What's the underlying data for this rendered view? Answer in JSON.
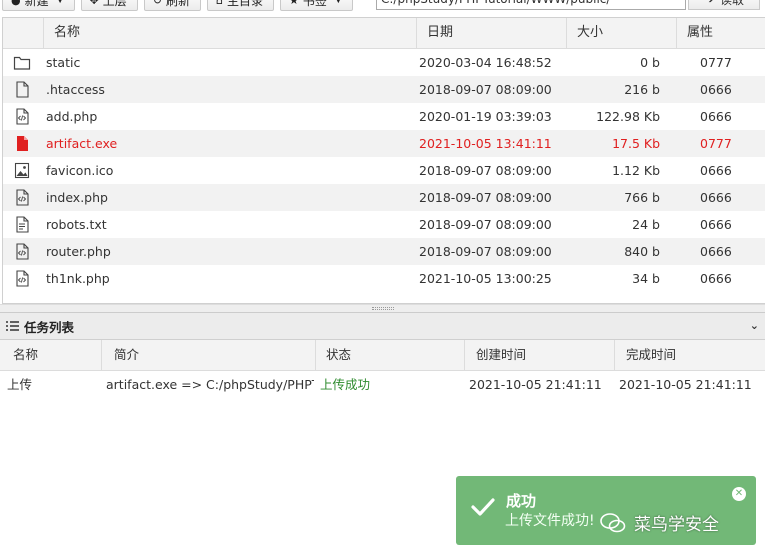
{
  "toolbar": {
    "new_label": "新建",
    "up_label": "上层",
    "refresh_label": "刷新",
    "home_label": "主目录",
    "bookmark_label": "书签",
    "path_value": "C:/phpStudy/PHPTutorial/WWW/public/",
    "read_label": "读取"
  },
  "files": {
    "headers": {
      "name": "名称",
      "date": "日期",
      "size": "大小",
      "attr": "属性"
    },
    "rows": [
      {
        "name": "static",
        "date": "2020-03-04 16:48:52",
        "size": "0 b",
        "attr": "0777",
        "icon": "folder-icon"
      },
      {
        "name": ".htaccess",
        "date": "2018-09-07 08:09:00",
        "size": "216 b",
        "attr": "0666",
        "icon": "file-icon"
      },
      {
        "name": "add.php",
        "date": "2020-01-19 03:39:03",
        "size": "122.98 Kb",
        "attr": "0666",
        "icon": "code-file-icon"
      },
      {
        "name": "artifact.exe",
        "date": "2021-10-05 13:41:11",
        "size": "17.5 Kb",
        "attr": "0777",
        "icon": "red-file-icon"
      },
      {
        "name": "favicon.ico",
        "date": "2018-09-07 08:09:00",
        "size": "1.12 Kb",
        "attr": "0666",
        "icon": "image-file-icon"
      },
      {
        "name": "index.php",
        "date": "2018-09-07 08:09:00",
        "size": "766 b",
        "attr": "0666",
        "icon": "code-file-icon"
      },
      {
        "name": "robots.txt",
        "date": "2018-09-07 08:09:00",
        "size": "24 b",
        "attr": "0666",
        "icon": "text-file-icon"
      },
      {
        "name": "router.php",
        "date": "2018-09-07 08:09:00",
        "size": "840 b",
        "attr": "0666",
        "icon": "code-file-icon"
      },
      {
        "name": "th1nk.php",
        "date": "2021-10-05 13:00:25",
        "size": "34 b",
        "attr": "0666",
        "icon": "code-file-icon"
      }
    ]
  },
  "tasks": {
    "title": "任务列表",
    "headers": {
      "name": "名称",
      "desc": "简介",
      "status": "状态",
      "created": "创建时间",
      "finished": "完成时间"
    },
    "rows": [
      {
        "name": "上传",
        "desc": "artifact.exe => C:/phpStudy/PHPTutorial/WWW/public/artifact.exe",
        "status": "上传成功",
        "created": "2021-10-05 21:41:11",
        "finished": "2021-10-05 21:41:11"
      }
    ]
  },
  "toast": {
    "title": "成功",
    "message": "上传文件成功!"
  },
  "watermark": {
    "text": "菜鸟学安全"
  },
  "colors": {
    "danger": "#e02020",
    "success_text": "#2e8b2e",
    "toast_bg": "#72b877"
  }
}
